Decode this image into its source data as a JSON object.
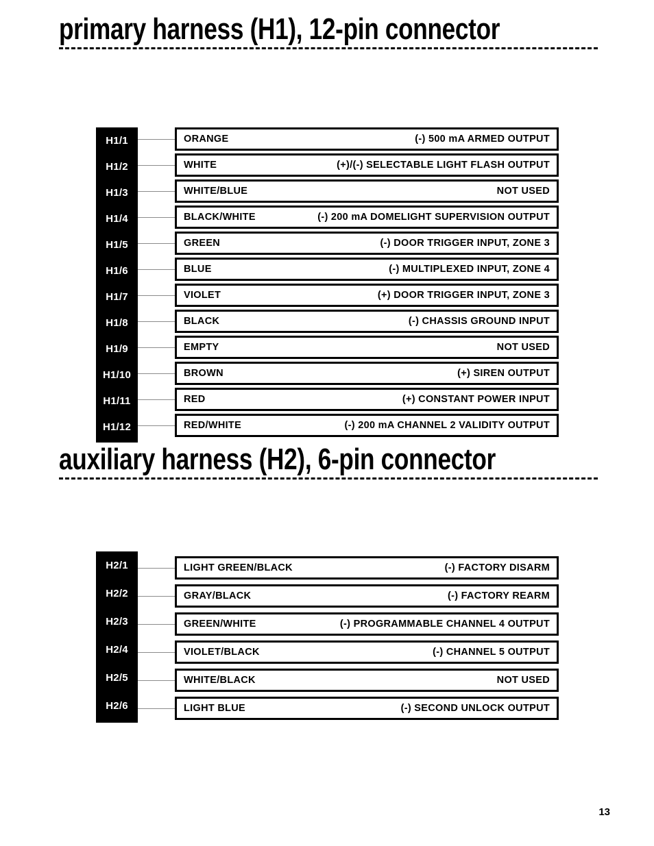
{
  "page": {
    "number": "13",
    "background_color": "#ffffff",
    "text_color": "#000000",
    "pin_column_color": "#000000",
    "leader_line_color": "#8b8b8b"
  },
  "sections": [
    {
      "id": "h1",
      "heading": "primary harness (H1), 12-pin connector",
      "rows": [
        {
          "pin": "H1/1",
          "wire": "ORANGE",
          "function": "(-) 500 mA ARMED OUTPUT"
        },
        {
          "pin": "H1/2",
          "wire": "WHITE",
          "function": "(+)/(-) SELECTABLE LIGHT FLASH OUTPUT"
        },
        {
          "pin": "H1/3",
          "wire": "WHITE/BLUE",
          "function": "NOT USED"
        },
        {
          "pin": "H1/4",
          "wire": "BLACK/WHITE",
          "function": "(-) 200 mA DOMELIGHT SUPERVISION OUTPUT"
        },
        {
          "pin": "H1/5",
          "wire": "GREEN",
          "function": "(-) DOOR TRIGGER INPUT, ZONE 3"
        },
        {
          "pin": "H1/6",
          "wire": "BLUE",
          "function": "(-) MULTIPLEXED INPUT, ZONE 4"
        },
        {
          "pin": "H1/7",
          "wire": "VIOLET",
          "function": "(+) DOOR TRIGGER INPUT, ZONE 3"
        },
        {
          "pin": "H1/8",
          "wire": "BLACK",
          "function": "(-) CHASSIS GROUND INPUT"
        },
        {
          "pin": "H1/9",
          "wire": "EMPTY",
          "function": "NOT USED"
        },
        {
          "pin": "H1/10",
          "wire": "BROWN",
          "function": "(+) SIREN OUTPUT"
        },
        {
          "pin": "H1/11",
          "wire": "RED",
          "function": "(+) CONSTANT POWER INPUT"
        },
        {
          "pin": "H1/12",
          "wire": "RED/WHITE",
          "function": "(-) 200 mA CHANNEL 2 VALIDITY OUTPUT"
        }
      ]
    },
    {
      "id": "h2",
      "heading": "auxiliary harness (H2), 6-pin connector",
      "rows": [
        {
          "pin": "H2/1",
          "wire": "LIGHT GREEN/BLACK",
          "function": "(-) FACTORY DISARM"
        },
        {
          "pin": "H2/2",
          "wire": "GRAY/BLACK",
          "function": "(-) FACTORY REARM"
        },
        {
          "pin": "H2/3",
          "wire": "GREEN/WHITE",
          "function": "(-) PROGRAMMABLE CHANNEL 4 OUTPUT"
        },
        {
          "pin": "H2/4",
          "wire": "VIOLET/BLACK",
          "function": "(-) CHANNEL 5 OUTPUT"
        },
        {
          "pin": "H2/5",
          "wire": "WHITE/BLACK",
          "function": "NOT USED"
        },
        {
          "pin": "H2/6",
          "wire": "LIGHT BLUE",
          "function": "(-) SECOND UNLOCK OUTPUT"
        }
      ]
    }
  ]
}
